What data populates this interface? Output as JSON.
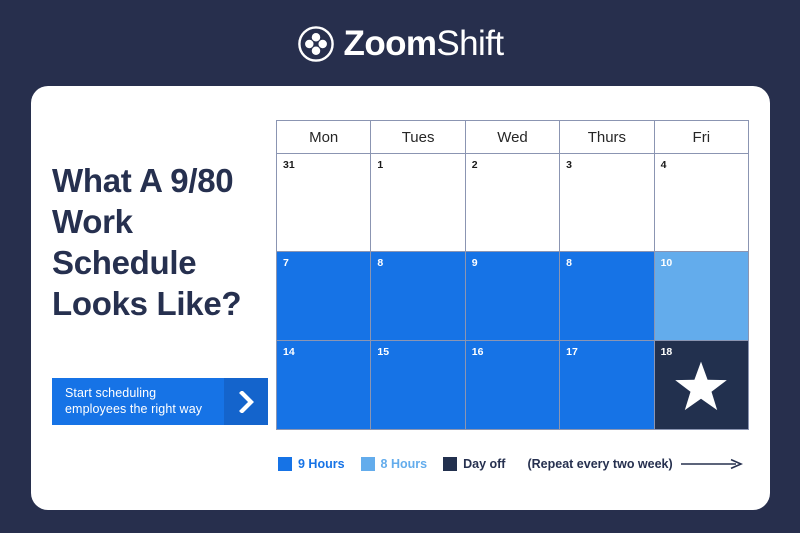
{
  "brand": {
    "name_strong": "Zoom",
    "name_light": "Shift",
    "logo_icon": "zoomshift-clover-circle-icon"
  },
  "hero": {
    "headline": "What A 9/80 Work Schedule Looks Like?",
    "cta": {
      "line1": "Start scheduling",
      "line2": "employees the right way",
      "arrow_icon": "chevron-right-icon"
    }
  },
  "calendar": {
    "day_headers": [
      "Mon",
      "Tues",
      "Wed",
      "Thurs",
      "Fri"
    ],
    "rows": [
      {
        "cells": [
          {
            "date": "31",
            "type": "empty"
          },
          {
            "date": "1",
            "type": "empty"
          },
          {
            "date": "2",
            "type": "empty"
          },
          {
            "date": "3",
            "type": "empty"
          },
          {
            "date": "4",
            "type": "empty"
          }
        ]
      },
      {
        "cells": [
          {
            "date": "7",
            "type": "nine"
          },
          {
            "date": "8",
            "type": "nine"
          },
          {
            "date": "9",
            "type": "nine"
          },
          {
            "date": "8",
            "type": "nine"
          },
          {
            "date": "10",
            "type": "eight"
          }
        ]
      },
      {
        "cells": [
          {
            "date": "14",
            "type": "nine"
          },
          {
            "date": "15",
            "type": "nine"
          },
          {
            "date": "16",
            "type": "nine"
          },
          {
            "date": "17",
            "type": "nine"
          },
          {
            "date": "18",
            "type": "off",
            "icon": "star-icon"
          }
        ]
      }
    ]
  },
  "legend": {
    "items": [
      {
        "label": "9 Hours",
        "color": "#1673E6"
      },
      {
        "label": "8 Hours",
        "color": "#63ACEC"
      },
      {
        "label": "Day off",
        "color": "#22304E"
      }
    ],
    "note": "(Repeat every two week)",
    "note_icon": "long-right-arrow-icon"
  },
  "theme": {
    "background": "#272F4D",
    "card": "#FFFFFF",
    "primary_blue": "#1673E6",
    "light_blue": "#63ACEC",
    "navy": "#26304F",
    "grid_line": "#8B95B2"
  }
}
